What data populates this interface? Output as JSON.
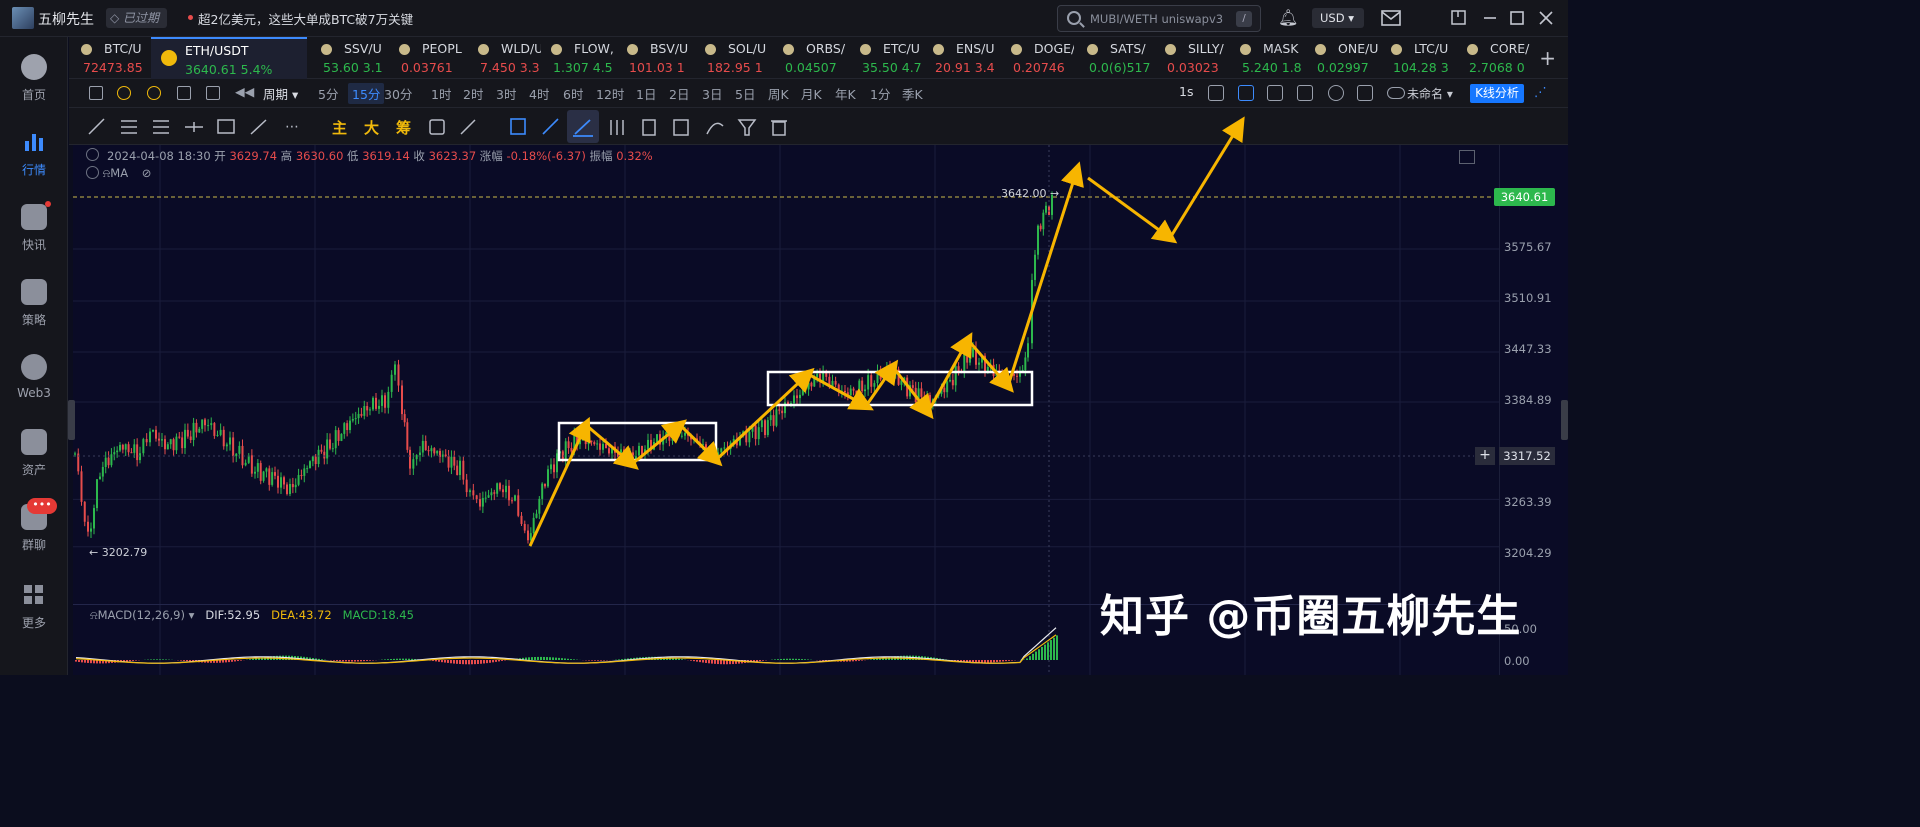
{
  "app": {
    "name": "五柳先生",
    "expired_label": "已过期",
    "news": "超2亿美元，这些大单成BTC破7万关键",
    "search_placeholder": "MUBI/WETH uniswapv3",
    "search_shortcut": "/",
    "currency": "USD"
  },
  "sidebar": [
    {
      "label": "首页"
    },
    {
      "label": "行情"
    },
    {
      "label": "快讯"
    },
    {
      "label": "策略"
    },
    {
      "label": "Web3"
    },
    {
      "label": "资产"
    },
    {
      "label": "群聊",
      "badge": "•••"
    },
    {
      "label": "更多"
    }
  ],
  "tickers": [
    {
      "name": "BTC/U",
      "value": "72473.85",
      "color": "#e74c4c"
    },
    {
      "name": "ETH/USDT",
      "value": "3640.61  5.4%",
      "color": "#2db84d",
      "active": true
    },
    {
      "name": "SSV/U",
      "value": "53.60  3.1",
      "color": "#2db84d"
    },
    {
      "name": "PEOPL",
      "value": "0.03761",
      "color": "#e74c4c"
    },
    {
      "name": "WLD/U",
      "value": "7.450  3.3",
      "color": "#e74c4c"
    },
    {
      "name": "FLOW,",
      "value": "1.307  4.5",
      "color": "#2db84d"
    },
    {
      "name": "BSV/U",
      "value": "101.03  1",
      "color": "#e74c4c"
    },
    {
      "name": "SOL/U",
      "value": "182.95  1",
      "color": "#e74c4c"
    },
    {
      "name": "ORBS/",
      "value": "0.04507",
      "color": "#2db84d"
    },
    {
      "name": "ETC/U",
      "value": "35.50  4.7",
      "color": "#2db84d"
    },
    {
      "name": "ENS/U",
      "value": "20.91  3.4",
      "color": "#e74c4c"
    },
    {
      "name": "DOGE/",
      "value": "0.20746",
      "color": "#e74c4c"
    },
    {
      "name": "SATS/",
      "value": "0.0(6)517",
      "color": "#2db84d"
    },
    {
      "name": "SILLY/",
      "value": "0.03023",
      "color": "#e74c4c"
    },
    {
      "name": "MASK",
      "value": "5.240  1.8",
      "color": "#2db84d"
    },
    {
      "name": "ONE/U",
      "value": "0.02997",
      "color": "#2db84d"
    },
    {
      "name": "LTC/U",
      "value": "104.28  3",
      "color": "#2db84d"
    },
    {
      "name": "CORE/",
      "value": "2.7068  0",
      "color": "#2db84d"
    }
  ],
  "periods": {
    "cycle_label": "周期",
    "items": [
      "5分",
      "15分",
      "30分",
      "1时",
      "2时",
      "3时",
      "4时",
      "6时",
      "12时",
      "1日",
      "2日",
      "3日",
      "5日",
      "周K",
      "月K",
      "年K",
      "1分",
      "季K"
    ],
    "active": "15分",
    "interval": "1s",
    "layout_name": "未命名",
    "kline_button": "K线分析"
  },
  "drawbar": {
    "main": "主",
    "big": "大",
    "chip": "筹"
  },
  "chart": {
    "date": "2024-04-08 18:30",
    "open_label": "开",
    "open": "3629.74",
    "high_label": "高",
    "high": "3630.60",
    "low_label": "低",
    "low": "3619.14",
    "close_label": "收",
    "close": "3623.37",
    "change_label": "涨幅",
    "change": "-0.18%(-6.37)",
    "amplitude_label": "振幅",
    "amplitude": "0.32%",
    "ma_label": "MA",
    "high_marker": "3642.00",
    "low_marker": "3202.79",
    "current_price": "3640.61",
    "crosshair_price": "3317.52",
    "price_labels": [
      "3575.67",
      "3510.91",
      "3447.33",
      "3384.89",
      "3263.39",
      "3204.29",
      "50.00",
      "0.00"
    ],
    "macd": {
      "name": "MACD(12,26,9)",
      "dif": "DIF:52.95",
      "dea": "DEA:43.72",
      "macd": "MACD:18.45"
    },
    "watermark": "知乎 @币圈五柳先生",
    "colors": {
      "up": "#2db84d",
      "down": "#e74c4c",
      "arrow": "#f7b500",
      "box": "#ffffff"
    }
  }
}
